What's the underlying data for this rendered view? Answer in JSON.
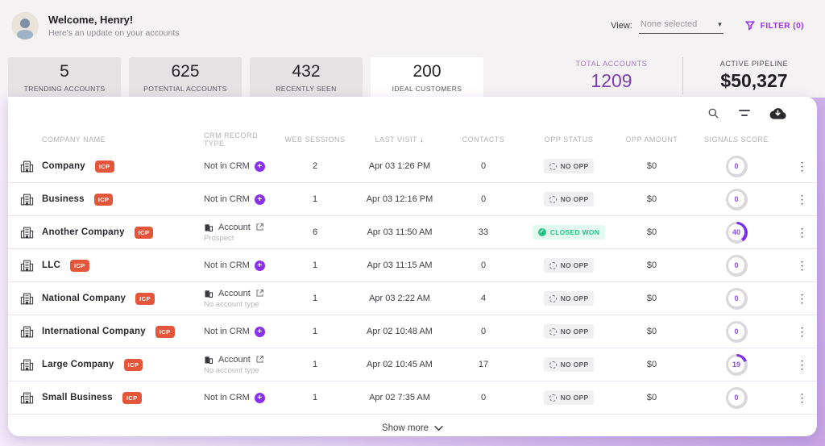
{
  "header": {
    "welcome": "Welcome, Henry!",
    "subtitle": "Here's an update on your accounts",
    "view_label": "View:",
    "view_value": "None selected",
    "filter_label": "FILTER (0)"
  },
  "icons": {
    "avatar": "person-icon",
    "filter": "funnel-icon",
    "search": "search-icon",
    "sort": "sort-lines-icon",
    "download": "cloud-download-icon",
    "kebab": "⋮",
    "dropdown_caret": "▾",
    "sort_desc_arrow": "↓",
    "show_more_chevron": "⌄",
    "plus": "+",
    "check": "✓"
  },
  "colors": {
    "accent_purple": "#8b2ff0",
    "icp_badge": "#e4553a",
    "won_green": "#25c385",
    "ring_track": "#d9d6dc",
    "ring_fill": "#7d30ea"
  },
  "stats": {
    "tabs": [
      {
        "value": "5",
        "label": "TRENDING ACCOUNTS",
        "selected": false
      },
      {
        "value": "625",
        "label": "POTENTIAL ACCOUNTS",
        "selected": false
      },
      {
        "value": "432",
        "label": "RECENTLY SEEN",
        "selected": false
      },
      {
        "value": "200",
        "label": "IDEAL CUSTOMERS",
        "selected": true
      }
    ],
    "total_accounts": {
      "label": "TOTAL ACCOUNTS",
      "value": "1209"
    },
    "active_pipeline": {
      "label": "ACTIVE PIPELINE",
      "value": "$50,327"
    }
  },
  "table": {
    "columns": [
      "COMPANY NAME",
      "CRM RECORD TYPE",
      "WEB SESSIONS",
      "LAST VISIT",
      "CONTACTS",
      "OPP STATUS",
      "OPP AMOUNT",
      "SIGNALS SCORE"
    ],
    "sorted_column": "LAST VISIT",
    "sort_direction": "desc",
    "icp_badge_label": "ICP",
    "rows": [
      {
        "company": "Company",
        "icp": true,
        "crm_type": "Not in CRM",
        "crm_sub": "",
        "in_crm": false,
        "sessions": "2",
        "last_visit": "Apr 03 1:26 PM",
        "contacts": "0",
        "opp_status": "NO OPP",
        "opp_kind": "none",
        "opp_amount": "$0",
        "score": 0
      },
      {
        "company": "Business",
        "icp": true,
        "crm_type": "Not in CRM",
        "crm_sub": "",
        "in_crm": false,
        "sessions": "1",
        "last_visit": "Apr 03 12:16 PM",
        "contacts": "0",
        "opp_status": "NO OPP",
        "opp_kind": "none",
        "opp_amount": "$0",
        "score": 0
      },
      {
        "company": "Another Company",
        "icp": true,
        "crm_type": "Account",
        "crm_sub": "Prospect",
        "in_crm": true,
        "sessions": "6",
        "last_visit": "Apr 03 11:50 AM",
        "contacts": "33",
        "opp_status": "CLOSED WON",
        "opp_kind": "won",
        "opp_amount": "$0",
        "score": 40
      },
      {
        "company": "LLC",
        "icp": true,
        "crm_type": "Not in CRM",
        "crm_sub": "",
        "in_crm": false,
        "sessions": "1",
        "last_visit": "Apr 03 11:15 AM",
        "contacts": "0",
        "opp_status": "NO OPP",
        "opp_kind": "none",
        "opp_amount": "$0",
        "score": 0
      },
      {
        "company": "National Company",
        "icp": true,
        "crm_type": "Account",
        "crm_sub": "No account type",
        "in_crm": true,
        "sessions": "1",
        "last_visit": "Apr 03 2:22 AM",
        "contacts": "4",
        "opp_status": "NO OPP",
        "opp_kind": "none",
        "opp_amount": "$0",
        "score": 0
      },
      {
        "company": "International Company",
        "icp": true,
        "crm_type": "Not in CRM",
        "crm_sub": "",
        "in_crm": false,
        "sessions": "1",
        "last_visit": "Apr 02 10:48 AM",
        "contacts": "0",
        "opp_status": "NO OPP",
        "opp_kind": "none",
        "opp_amount": "$0",
        "score": 0
      },
      {
        "company": "Large Company",
        "icp": true,
        "crm_type": "Account",
        "crm_sub": "No account type",
        "in_crm": true,
        "sessions": "1",
        "last_visit": "Apr 02 10:45 AM",
        "contacts": "17",
        "opp_status": "NO OPP",
        "opp_kind": "none",
        "opp_amount": "$0",
        "score": 19
      },
      {
        "company": "Small Business",
        "icp": true,
        "crm_type": "Not in CRM",
        "crm_sub": "",
        "in_crm": false,
        "sessions": "1",
        "last_visit": "Apr 02 7:35 AM",
        "contacts": "0",
        "opp_status": "NO OPP",
        "opp_kind": "none",
        "opp_amount": "$0",
        "score": 0
      }
    ]
  },
  "footer": {
    "show_more": "Show more"
  }
}
